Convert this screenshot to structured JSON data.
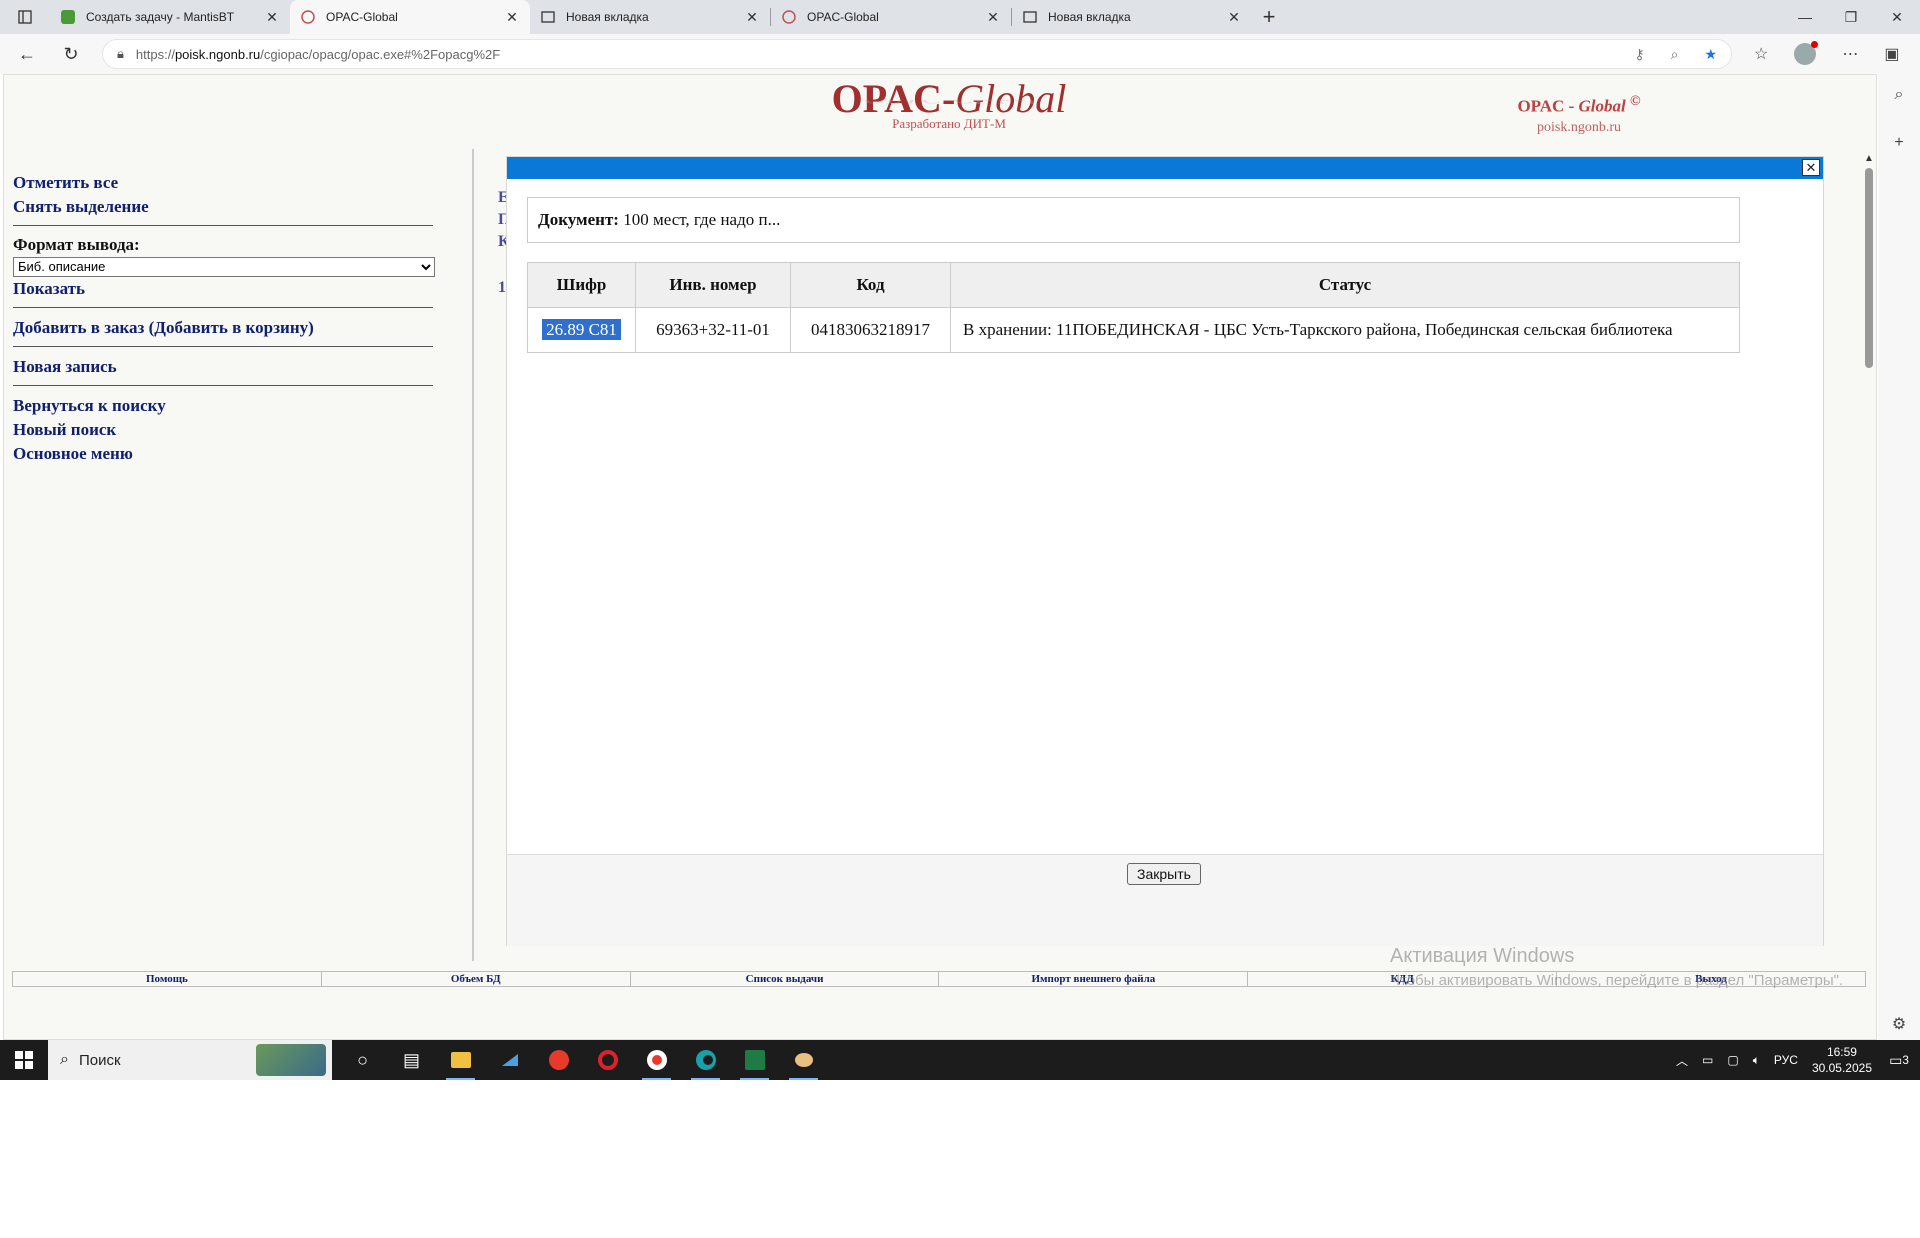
{
  "browser": {
    "tabs": [
      {
        "title": "Создать задачу - MantisBT",
        "active": false
      },
      {
        "title": "OPAC-Global",
        "active": true
      },
      {
        "title": "Новая вкладка",
        "active": false
      },
      {
        "title": "OPAC-Global",
        "active": false
      },
      {
        "title": "Новая вкладка",
        "active": false
      }
    ],
    "url_prefix": "https://",
    "url_host": "poisk.ngonb.ru",
    "url_path": "/cgiopac/opacg/opac.exe#%2Fopacg%2F"
  },
  "header": {
    "logo_main": "OPAC-",
    "logo_italic": "Global",
    "logo_sub": "Разработано ДИТ-М",
    "logo2_main": "OPAC - ",
    "logo2_italic": "Global",
    "logo2_copy": "©",
    "logo2_url": "poisk.ngonb.ru"
  },
  "leftmenu": {
    "mark_all": "Отметить все",
    "unmark": "Снять выделение",
    "format_label": "Формат вывода:",
    "format_value": "Биб. описание",
    "show": "Показать",
    "add_order": "Добавить в заказ (Добавить в корзину)",
    "new_record": "Новая запись",
    "back_search": "Вернуться к поиску",
    "new_search": "Новый поиск",
    "main_menu": "Основное меню"
  },
  "behind": {
    "c1": "Е",
    "c2": "П",
    "c3": "К",
    "c4": "1"
  },
  "modal": {
    "doc_label": "Документ:",
    "doc_title": "100 мест, где надо п...",
    "columns": [
      "Шифр",
      "Инв. номер",
      "Код",
      "Статус"
    ],
    "rows": [
      {
        "shifr": "26.89 С81",
        "inv": "69363+32-11-01",
        "code": "04183063218917",
        "status": "В хранении: 11ПОБЕДИНСКАЯ - ЦБС Усть-Таркского района, Побединская сельская библиотека"
      }
    ],
    "close_button": "Закрыть"
  },
  "bottomlinks": [
    "Помощь",
    "Объем БД",
    "Список выдачи",
    "Импорт внешнего файла",
    "КДД",
    "Выход"
  ],
  "watermark": {
    "line1": "Активация Windows",
    "line2": "Чтобы активировать Windows, перейдите в раздел \"Параметры\"."
  },
  "taskbar": {
    "search_placeholder": "Поиск",
    "lang": "РУС",
    "time": "16:59",
    "date": "30.05.2025",
    "notif_count": "3"
  }
}
